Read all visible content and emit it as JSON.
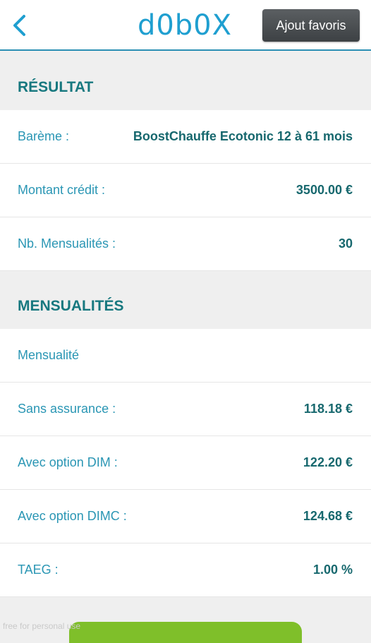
{
  "header": {
    "back_icon": "chevron-left-icon",
    "logo": "d0b0X",
    "favorite_label": "Ajout favoris",
    "accent": "#2a8fb4"
  },
  "result": {
    "title": "RÉSULTAT",
    "rows": [
      {
        "label": "Barème :",
        "value": "BoostChauffe Ecotonic 12 à 61 mois"
      },
      {
        "label": "Montant crédit :",
        "value": "3500.00 €"
      },
      {
        "label": "Nb. Mensualités :",
        "value": "30"
      }
    ]
  },
  "installments": {
    "title": "MENSUALITÉS",
    "rows": [
      {
        "label": "Mensualité",
        "value": ""
      },
      {
        "label": "Sans assurance :",
        "value": "118.18 €"
      },
      {
        "label": "Avec option DIM :",
        "value": "122.20 €"
      },
      {
        "label": "Avec option DIMC :",
        "value": "124.68 €"
      },
      {
        "label": "TAEG :",
        "value": "1.00 %"
      }
    ]
  },
  "footer": {
    "watermark": "free for personal use",
    "button_color": "#7fbf2a"
  }
}
